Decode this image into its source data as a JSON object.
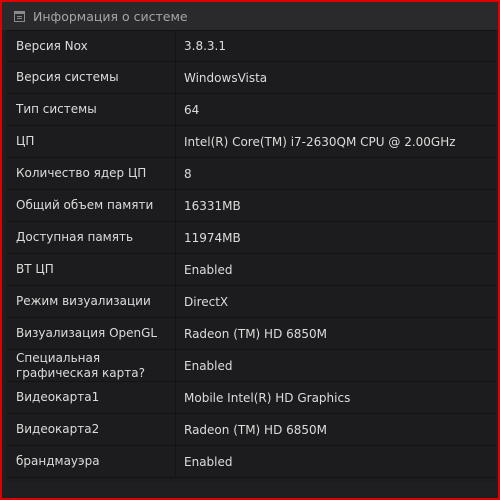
{
  "window": {
    "title": "Информация о системе",
    "title_icon": "info-list-icon"
  },
  "info_rows": [
    {
      "label": "Версия Nox",
      "value": "3.8.3.1"
    },
    {
      "label": "Версия системы",
      "value": "WindowsVista"
    },
    {
      "label": "Тип системы",
      "value": "64"
    },
    {
      "label": "ЦП",
      "value": "Intel(R) Core(TM) i7-2630QM CPU @ 2.00GHz"
    },
    {
      "label": "Количество ядер ЦП",
      "value": "8"
    },
    {
      "label": "Общий объем памяти",
      "value": "16331MB"
    },
    {
      "label": "Доступная память",
      "value": "11974MB"
    },
    {
      "label": "ВТ ЦП",
      "value": "Enabled"
    },
    {
      "label": "Режим визуализации",
      "value": "DirectX"
    },
    {
      "label": "Визуализация OpenGL",
      "value": "Radeon (TM) HD 6850M"
    },
    {
      "label": "Специальная графическая карта?",
      "value": "Enabled"
    },
    {
      "label": "Видеокарта1",
      "value": "Mobile Intel(R) HD Graphics"
    },
    {
      "label": "Видеокарта2",
      "value": "Radeon (TM) HD 6850M"
    },
    {
      "label": "брандмауэра",
      "value": "Enabled"
    }
  ],
  "colors": {
    "border_accent": "#e00000",
    "background": "#1f1f21",
    "titlebar": "#2a2a2d",
    "text": "#dcdcdc"
  }
}
